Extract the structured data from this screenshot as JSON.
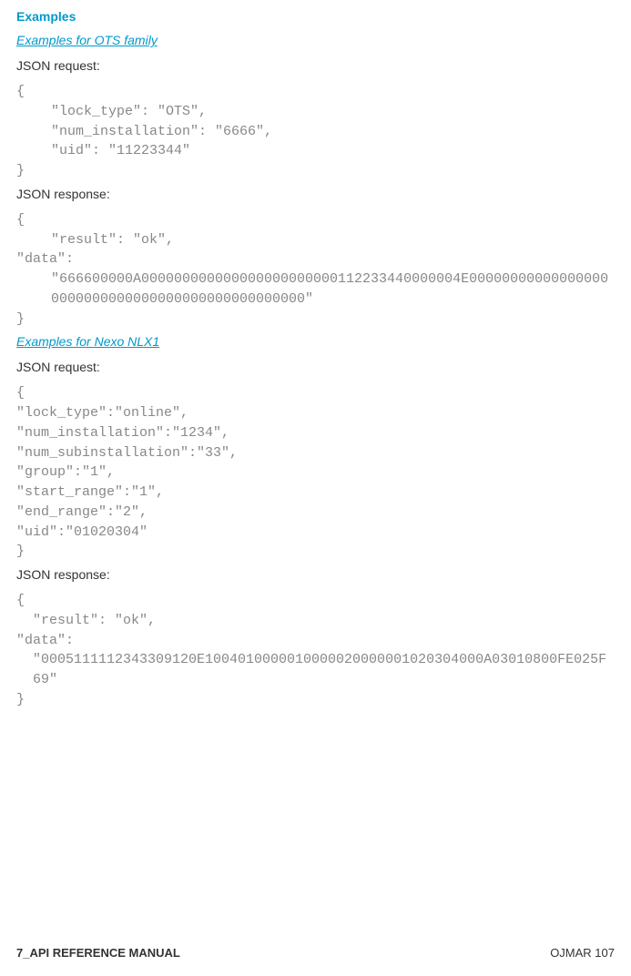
{
  "headings": {
    "examples": "Examples",
    "ots_family": "Examples for OTS family",
    "nexo_nlx1": "Examples for Nexo NLX1"
  },
  "labels": {
    "json_request": "JSON request:",
    "json_response": "JSON response:"
  },
  "code": {
    "ots_request": {
      "open": "{",
      "line1": "\"lock_type\": \"OTS\",",
      "line2": "\"num_installation\": \"6666\",",
      "line3": "\"uid\": \"11223344\"",
      "close": "}"
    },
    "ots_response": {
      "open": "{",
      "line1": "\"result\": \"ok\",",
      "line2": "\"data\": \"666600000A000000000000000000000000112233440000004E000000000000000000000000000000000000000000000000\"",
      "close": "}"
    },
    "nexo_request": {
      "open": "{",
      "line1": "\"lock_type\":\"online\",",
      "line2": "\"num_installation\":\"1234\",",
      "line3": "\"num_subinstallation\":\"33\",",
      "line4": "\"group\":\"1\",",
      "line5": "\"start_range\":\"1\",",
      "line6": "\"end_range\":\"2\",",
      "line7": "\"uid\":\"01020304\"",
      "close": "}"
    },
    "nexo_response": {
      "open": "{",
      "line1": "\"result\": \"ok\",",
      "line2": "\"data\": \"0005111112343309120E1004010000010000020000001020304000A03010800FE025F69\"",
      "close": "}"
    }
  },
  "footer": {
    "left": "7_API REFERENCE MANUAL",
    "right": "OJMAR 107"
  }
}
